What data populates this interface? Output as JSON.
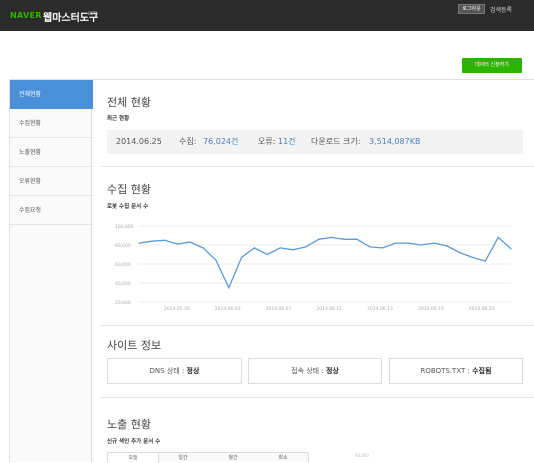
{
  "header": {
    "brand": "NAVER",
    "app_title": "웹마스터도구",
    "beta": "BETA",
    "logout": "로그아웃",
    "search_register": "검색등록"
  },
  "action_button": "데이터 신청하기",
  "sidebar": {
    "items": [
      {
        "label": "전체현황"
      },
      {
        "label": "수집현황"
      },
      {
        "label": "노출현황"
      },
      {
        "label": "오류현황"
      },
      {
        "label": "수집요청"
      }
    ]
  },
  "overview": {
    "title": "전체 현황",
    "subtitle": "최근 현황",
    "date": "2014.06.25",
    "collected_label": "수집:",
    "collected_value": "76,024건",
    "errors_label": "오류:",
    "errors_value": "11건",
    "download_label": "다운로드 크기:",
    "download_value": "3,514,087KB"
  },
  "collection": {
    "title": "수집 현황",
    "subtitle": "로봇 수집 문서 수"
  },
  "chart_data": {
    "type": "line",
    "y_ticks": [
      "100,000",
      "80,000",
      "60,000",
      "40,000",
      "20,000"
    ],
    "x_ticks": [
      "2014.05.30",
      "2014.06.03",
      "2014.06.07",
      "2014.06.11",
      "2014.06.15",
      "2014.06.19",
      "2014.06.23"
    ],
    "ylim": [
      20000,
      100000
    ],
    "grid": true,
    "color": "#5b9bd5",
    "series": [
      {
        "values": [
          82000,
          84000,
          85000,
          81000,
          83000,
          77000,
          64000,
          35000,
          67000,
          77000,
          70000,
          77000,
          75000,
          78000,
          86000,
          88000,
          86000,
          86000,
          78000,
          77000,
          82000,
          82000,
          80000,
          82000,
          79000,
          72000,
          67000,
          63000,
          88000,
          76000
        ]
      }
    ]
  },
  "site_info": {
    "title": "사이트 정보",
    "dns_label": "DNS 상태 :",
    "dns_value": "정상",
    "conn_label": "접속 상태 :",
    "conn_value": "정상",
    "robots_label": "ROBOTS.TXT :",
    "robots_value": "수집됨"
  },
  "exposure": {
    "title": "노출 현황",
    "subtitle": "신규 색인 추가 문서 수",
    "tabs": [
      "오늘",
      "일간",
      "월간",
      "최소"
    ],
    "mini_tick": "40,000"
  }
}
